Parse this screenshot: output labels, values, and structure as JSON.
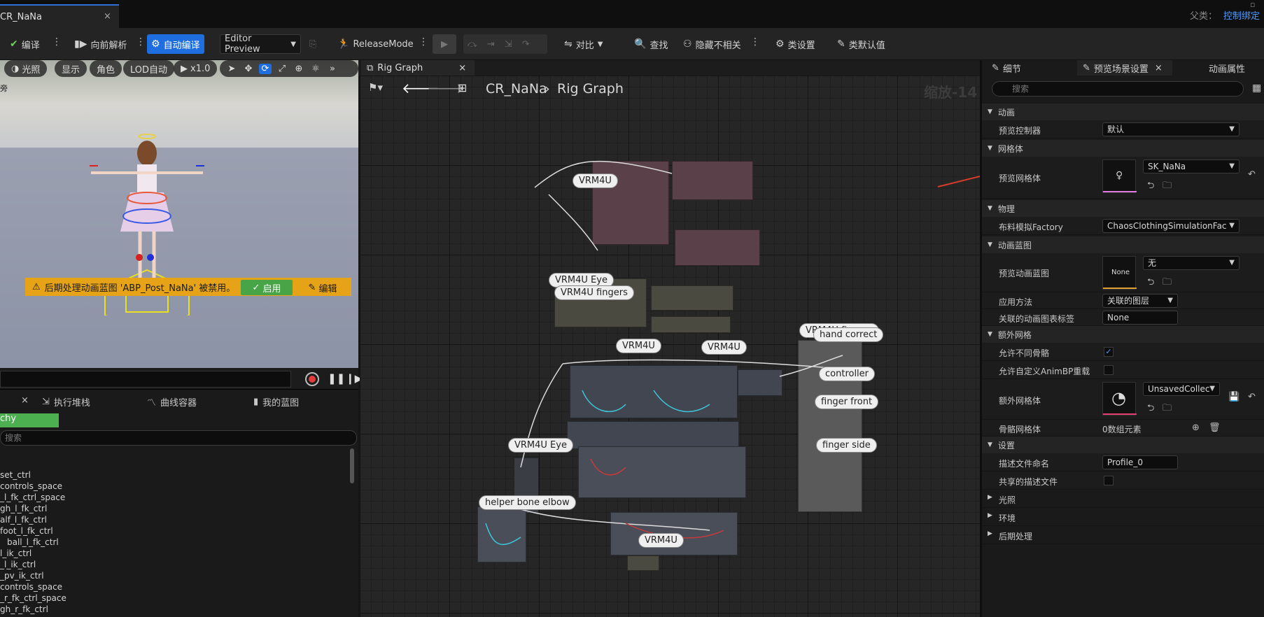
{
  "title_bar": {
    "doc_tab": "CR_NaNa",
    "doc_tab_close": "×",
    "parent_label": "父类：",
    "parent_value": "控制绑定"
  },
  "toolbar": {
    "compile": "编译",
    "step_back": "向前解析",
    "auto_compile": "自动编译",
    "preview_mode": "Editor Preview",
    "release_mode": "ReleaseMode",
    "diff": "对比",
    "find": "查找",
    "hide_unrelated": "隐藏不相关",
    "class_settings": "类设置",
    "class_defaults": "类默认值"
  },
  "viewport": {
    "lighting": "光照",
    "show": "显示",
    "role": "角色",
    "lod": "LOD自动",
    "speed": "x1.0",
    "left_text": "旁",
    "warning": "后期处理动画蓝图 'ABP_Post_NaNa' 被禁用。",
    "enable": "启用",
    "edit": "编辑"
  },
  "bottom_left": {
    "tabs": [
      "执行堆栈",
      "曲线容器",
      "我的蓝图"
    ],
    "tab_close": "×",
    "hierarchy_tab": "chy",
    "search_placeholder": "搜索",
    "items": [
      "set_ctrl",
      "controls_space",
      "_l_fk_ctrl_space",
      "gh_l_fk_ctrl",
      "alf_l_fk_ctrl",
      "foot_l_fk_ctrl",
      "ball_l_fk_ctrl",
      "l_ik_ctrl",
      "_l_ik_ctrl",
      "_pv_ik_ctrl",
      "controls_space",
      "_r_fk_ctrl_space",
      "gh_r_fk_ctrl"
    ]
  },
  "graph": {
    "tab": "Rig Graph",
    "tab_close": "×",
    "breadcrumb_root": "CR_NaNa",
    "breadcrumb_leaf": "Rig Graph",
    "zoom": "缩放-14",
    "comments": [
      {
        "label": "VRM4U"
      },
      {
        "label": "VRM4U Eye"
      },
      {
        "label": "VRM4U fingers"
      },
      {
        "label": "VRM4U"
      },
      {
        "label": "VRM4U"
      },
      {
        "label": "VRM4U fingers"
      },
      {
        "label": "hand correct"
      },
      {
        "label": "controller"
      },
      {
        "label": "finger front"
      },
      {
        "label": "finger side"
      },
      {
        "label": "VRM4U Eye"
      },
      {
        "label": "helper bone elbow"
      },
      {
        "label": "VRM4U"
      }
    ]
  },
  "details": {
    "tabs": [
      "细节",
      "预览场景设置",
      "动画属性"
    ],
    "tab_close": "×",
    "search_placeholder": "搜索",
    "sections": {
      "animation": "动画",
      "mesh": "网格体",
      "physics": "物理",
      "anim_bp": "动画蓝图",
      "extra_mesh": "额外网格",
      "settings": "设置",
      "lighting": "光照",
      "environment": "环境",
      "post_process": "后期处理"
    },
    "rows": {
      "preview_controller_label": "预览控制器",
      "preview_controller_value": "默认",
      "preview_mesh_label": "预览网格体",
      "preview_mesh_value": "SK_NaNa",
      "cloth_factory_label": "布料模拟Factory",
      "cloth_factory_value": "ChaosClothingSimulationFac",
      "preview_anim_bp_label": "预览动画蓝图",
      "preview_anim_bp_thumb": "None",
      "preview_anim_bp_value": "无",
      "apply_method_label": "应用方法",
      "apply_method_value": "关联的图层",
      "linked_tag_label": "关联的动画图表标签",
      "linked_tag_value": "None",
      "allow_diff_skel_label": "允许不同骨骼",
      "allow_custom_animbp_label": "允许自定义AnimBP重载",
      "extra_mesh_label": "额外网格体",
      "extra_mesh_value": "UnsavedCollec",
      "skeletal_mesh_label": "骨骼网格体",
      "skeletal_mesh_value": "0数组元素",
      "profile_name_label": "描述文件命名",
      "profile_name_value": "Profile_0",
      "shared_profile_label": "共享的描述文件"
    }
  },
  "colors": {
    "accent": "#1f6ee0",
    "warning": "#e6a317",
    "enable": "#47a447",
    "annotation": "#d63c2a"
  }
}
